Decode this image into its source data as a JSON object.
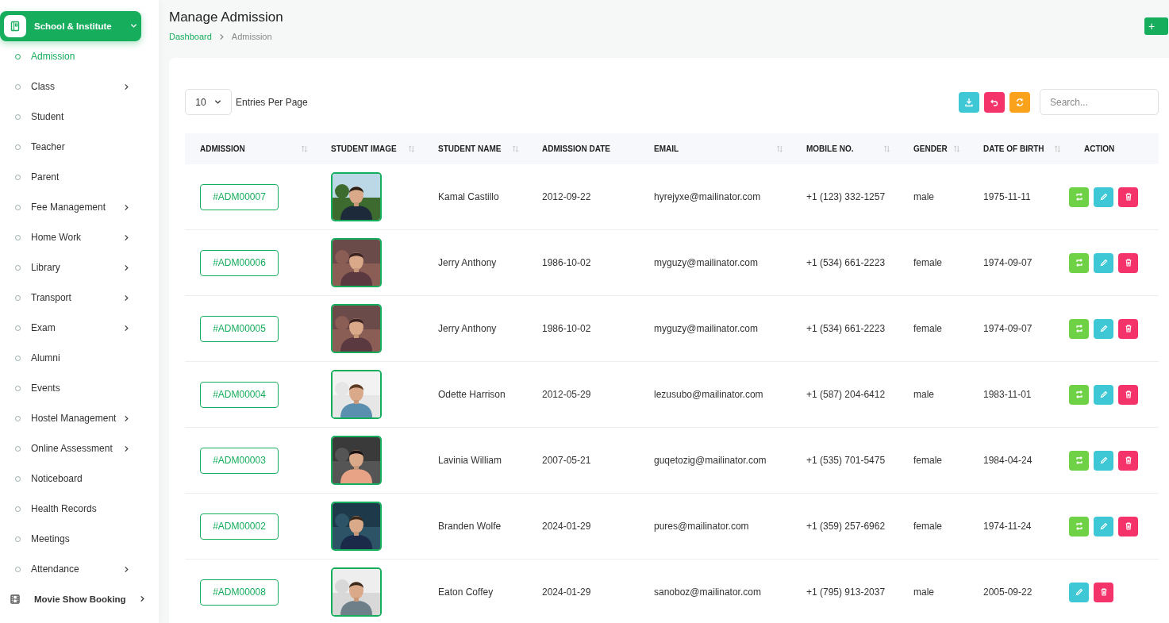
{
  "sidebar": {
    "groups": [
      {
        "label": "School & Institute",
        "selected": true,
        "expanded": true,
        "items": [
          {
            "label": "Admission",
            "selected": true,
            "expandable": false
          },
          {
            "label": "Class",
            "selected": false,
            "expandable": true
          },
          {
            "label": "Student",
            "selected": false,
            "expandable": false
          },
          {
            "label": "Teacher",
            "selected": false,
            "expandable": false
          },
          {
            "label": "Parent",
            "selected": false,
            "expandable": false
          },
          {
            "label": "Fee Management",
            "selected": false,
            "expandable": true
          },
          {
            "label": "Home Work",
            "selected": false,
            "expandable": true
          },
          {
            "label": "Library",
            "selected": false,
            "expandable": true
          },
          {
            "label": "Transport",
            "selected": false,
            "expandable": true
          },
          {
            "label": "Exam",
            "selected": false,
            "expandable": true
          },
          {
            "label": "Alumni",
            "selected": false,
            "expandable": false
          },
          {
            "label": "Events",
            "selected": false,
            "expandable": false
          },
          {
            "label": "Hostel Management",
            "selected": false,
            "expandable": true
          },
          {
            "label": "Online Assessment",
            "selected": false,
            "expandable": true
          },
          {
            "label": "Noticeboard",
            "selected": false,
            "expandable": false
          },
          {
            "label": "Health Records",
            "selected": false,
            "expandable": false
          },
          {
            "label": "Meetings",
            "selected": false,
            "expandable": false
          },
          {
            "label": "Attendance",
            "selected": false,
            "expandable": true
          }
        ]
      },
      {
        "label": "Movie Show Booking",
        "selected": false,
        "expanded": false
      }
    ]
  },
  "header": {
    "title": "Manage Admission",
    "breadcrumb": [
      "Dashboard",
      "Admission"
    ],
    "add_button": "+"
  },
  "toolbar": {
    "page_size": "10",
    "page_size_label": "Entries Per Page",
    "search": {
      "placeholder": "Search..."
    },
    "buttons": [
      {
        "kind": "download"
      },
      {
        "kind": "undo"
      },
      {
        "kind": "refresh"
      }
    ]
  },
  "table": {
    "columns": [
      {
        "label": "ADMISSION",
        "sortable": true
      },
      {
        "label": "STUDENT IMAGE",
        "sortable": true
      },
      {
        "label": "STUDENT NAME",
        "sortable": true
      },
      {
        "label": "ADMISSION DATE",
        "sortable": false
      },
      {
        "label": "EMAIL",
        "sortable": true
      },
      {
        "label": "MOBILE NO.",
        "sortable": true
      },
      {
        "label": "GENDER",
        "sortable": true
      },
      {
        "label": "DATE OF BIRTH",
        "sortable": true
      },
      {
        "label": "ACTION",
        "sortable": false
      }
    ],
    "rows": [
      {
        "admission": "#ADM00007",
        "image": {
          "kind": "picture"
        },
        "name": "Kamal Castillo",
        "date": "2012-09-22",
        "email": "hyrejyxe@mailinator.com",
        "mobile": "+1 (123) 332-1257",
        "gender": "male",
        "dob": "1975-11-11",
        "actions": [
          {
            "kind": "convert"
          },
          {
            "kind": "edit"
          },
          {
            "kind": "delete"
          }
        ]
      },
      {
        "admission": "#ADM00006",
        "image": {
          "kind": "picture"
        },
        "name": "Jerry Anthony",
        "date": "1986-10-02",
        "email": "myguzy@mailinator.com",
        "mobile": "+1 (534) 661-2223",
        "gender": "female",
        "dob": "1974-09-07",
        "actions": [
          {
            "kind": "convert"
          },
          {
            "kind": "edit"
          },
          {
            "kind": "delete"
          }
        ]
      },
      {
        "admission": "#ADM00005",
        "image": {
          "kind": "picture"
        },
        "name": "Jerry Anthony",
        "date": "1986-10-02",
        "email": "myguzy@mailinator.com",
        "mobile": "+1 (534) 661-2223",
        "gender": "female",
        "dob": "1974-09-07",
        "actions": [
          {
            "kind": "convert"
          },
          {
            "kind": "edit"
          },
          {
            "kind": "delete"
          }
        ]
      },
      {
        "admission": "#ADM00004",
        "image": {
          "kind": "picture"
        },
        "name": "Odette Harrison",
        "date": "2012-05-29",
        "email": "lezusubo@mailinator.com",
        "mobile": "+1 (587) 204-6412",
        "gender": "male",
        "dob": "1983-11-01",
        "actions": [
          {
            "kind": "convert"
          },
          {
            "kind": "edit"
          },
          {
            "kind": "delete"
          }
        ]
      },
      {
        "admission": "#ADM00003",
        "image": {
          "kind": "picture"
        },
        "name": "Lavinia William",
        "date": "2007-05-21",
        "email": "guqetozig@mailinator.com",
        "mobile": "+1 (535) 701-5475",
        "gender": "female",
        "dob": "1984-04-24",
        "actions": [
          {
            "kind": "convert"
          },
          {
            "kind": "edit"
          },
          {
            "kind": "delete"
          }
        ]
      },
      {
        "admission": "#ADM00002",
        "image": {
          "kind": "picture"
        },
        "name": "Branden Wolfe",
        "date": "2024-01-29",
        "email": "pures@mailinator.com",
        "mobile": "+1 (359) 257-6962",
        "gender": "female",
        "dob": "1974-11-24",
        "actions": [
          {
            "kind": "convert"
          },
          {
            "kind": "edit"
          },
          {
            "kind": "delete"
          }
        ]
      },
      {
        "admission": "#ADM00008",
        "image": {
          "kind": "picture"
        },
        "name": "Eaton Coffey",
        "date": "2024-01-29",
        "email": "sanoboz@mailinator.com",
        "mobile": "+1 (795) 913-2037",
        "gender": "male",
        "dob": "2005-09-22",
        "actions": [
          {
            "kind": "edit"
          },
          {
            "kind": "delete"
          }
        ]
      }
    ]
  }
}
